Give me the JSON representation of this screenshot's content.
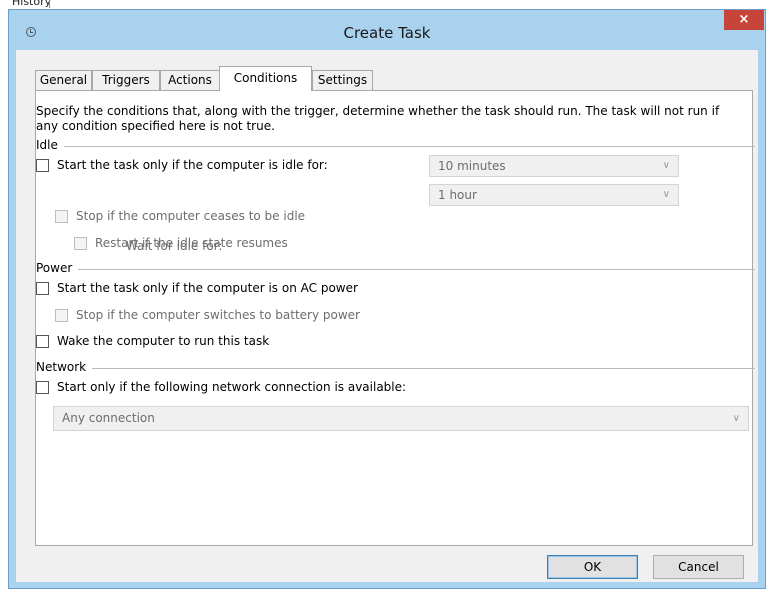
{
  "background": {
    "history_label": "History"
  },
  "window": {
    "title": "Create Task",
    "close_glyph": "×",
    "icon": "clock-icon"
  },
  "tabs": [
    {
      "label": "General"
    },
    {
      "label": "Triggers"
    },
    {
      "label": "Actions"
    },
    {
      "label": "Conditions",
      "active": true
    },
    {
      "label": "Settings"
    }
  ],
  "description": "Specify the conditions that, along with the trigger, determine whether the task should run.  The task will not run  if any condition specified here is not true.",
  "idle": {
    "label": "Idle",
    "start_if_idle": {
      "label": "Start the task only if the computer is idle for:",
      "checked": false
    },
    "idle_duration": {
      "value": "10 minutes"
    },
    "wait_label": "Wait for idle for:",
    "wait_duration": {
      "value": "1 hour"
    },
    "stop_if_ceases": {
      "label": "Stop if the computer ceases to be idle",
      "checked": false
    },
    "restart_if_resumes": {
      "label": "Restart if the idle state resumes",
      "checked": false
    }
  },
  "power": {
    "label": "Power",
    "start_on_ac": {
      "label": "Start the task only if the computer is on AC power",
      "checked": false
    },
    "stop_on_battery": {
      "label": "Stop if the computer switches to battery power",
      "checked": false
    },
    "wake_to_run": {
      "label": "Wake the computer to run this task",
      "checked": false
    }
  },
  "network": {
    "label": "Network",
    "start_if_network": {
      "label": "Start only if the following network connection is available:",
      "checked": false
    },
    "connection": {
      "value": "Any connection"
    }
  },
  "buttons": {
    "ok": "OK",
    "cancel": "Cancel"
  },
  "colors": {
    "title_bar": "#a9d2ee",
    "close_button": "#c7443a",
    "dialog_bg": "#f0f0f0"
  }
}
